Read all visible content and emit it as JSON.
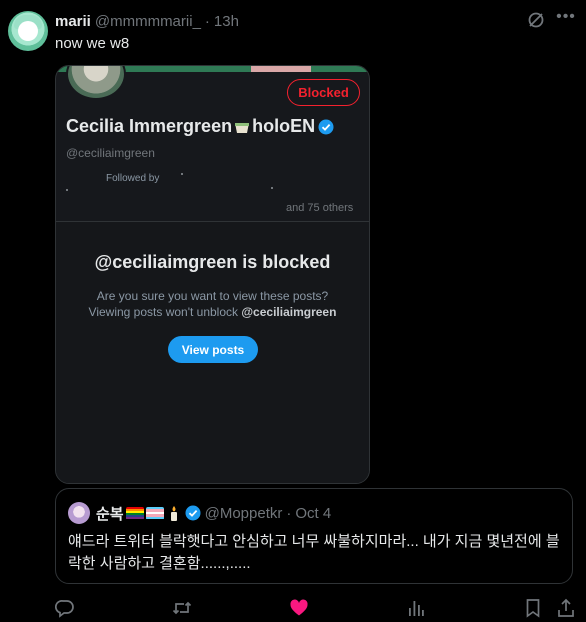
{
  "post": {
    "author_name": "marii",
    "author_handle": "@mmmmmarii_",
    "separator": "·",
    "time": "13h",
    "text": "now we w8"
  },
  "media": {
    "blocked_button": "Blocked",
    "profile_name_part1": "Cecilia Immergreen",
    "profile_name_part2": "holoEN",
    "profile_handle": "@ceciliaimgreen",
    "followed_by": "Followed by",
    "and_others": "and 75 others",
    "blocked_title": "@ceciliaimgreen is blocked",
    "blocked_question": "Are you sure you want to view these posts?",
    "blocked_sub_prefix": "Viewing posts won't unblock ",
    "blocked_sub_handle": "@ceciliaimgreen",
    "view_posts_button": "View posts"
  },
  "quote": {
    "author_name": "순복",
    "author_handle": "@Moppetkr",
    "separator": "·",
    "time": "Oct 4",
    "text": "얘드라 트위터 블락햇다고 안심하고 너무 싸불하지마라... 내가 지금 몇년전에 블락한 사람하고 결혼함......,....."
  },
  "icons": {
    "more": "more-icon",
    "grok": "grok-icon",
    "verified": "verified-icon",
    "reply": "reply-icon",
    "repost": "repost-icon",
    "like": "like-icon",
    "views": "views-icon",
    "bookmark": "bookmark-icon",
    "share": "share-icon"
  },
  "colors": {
    "background": "#000000",
    "text_primary": "#e7e9ea",
    "text_secondary": "#71767b",
    "accent_blue": "#1d9bf0",
    "blocked_red": "#f4212e",
    "like_pink": "#f91880"
  }
}
